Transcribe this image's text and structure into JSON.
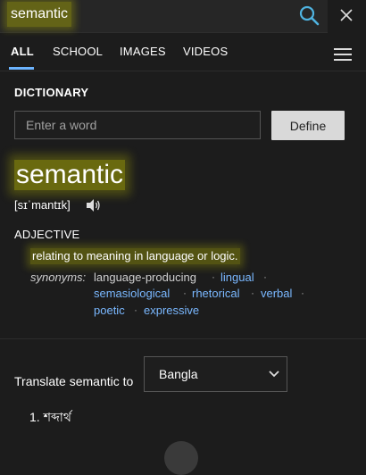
{
  "search": {
    "query": "semantic"
  },
  "tabs": [
    {
      "label": "ALL"
    },
    {
      "label": "SCHOOL"
    },
    {
      "label": "IMAGES"
    },
    {
      "label": "VIDEOS"
    }
  ],
  "dictionary": {
    "heading": "DICTIONARY",
    "input_placeholder": "Enter a word",
    "input_value": "",
    "define_label": "Define"
  },
  "entry": {
    "word": "semantic",
    "pronunciation": "[sɪˈmantɪk]",
    "part_of_speech": "ADJECTIVE",
    "definition": "relating to meaning in language or logic.",
    "synonyms_label": "synonyms:",
    "synonyms": [
      "language-producing",
      "lingual",
      "semasiological",
      "rhetorical",
      "verbal",
      "poetic",
      "expressive"
    ]
  },
  "translate": {
    "label": "Translate semantic to",
    "language": "Bangla",
    "result_number": "1.",
    "result_text": "শব্দার্থ"
  },
  "colors": {
    "background": "#1c1c1c",
    "link": "#7ab8ff",
    "accent": "#6cb4ff",
    "highlight": "#c8c800"
  },
  "icons": [
    "search-icon",
    "close-icon",
    "menu-icon",
    "speaker-icon",
    "chevron-down-icon"
  ]
}
